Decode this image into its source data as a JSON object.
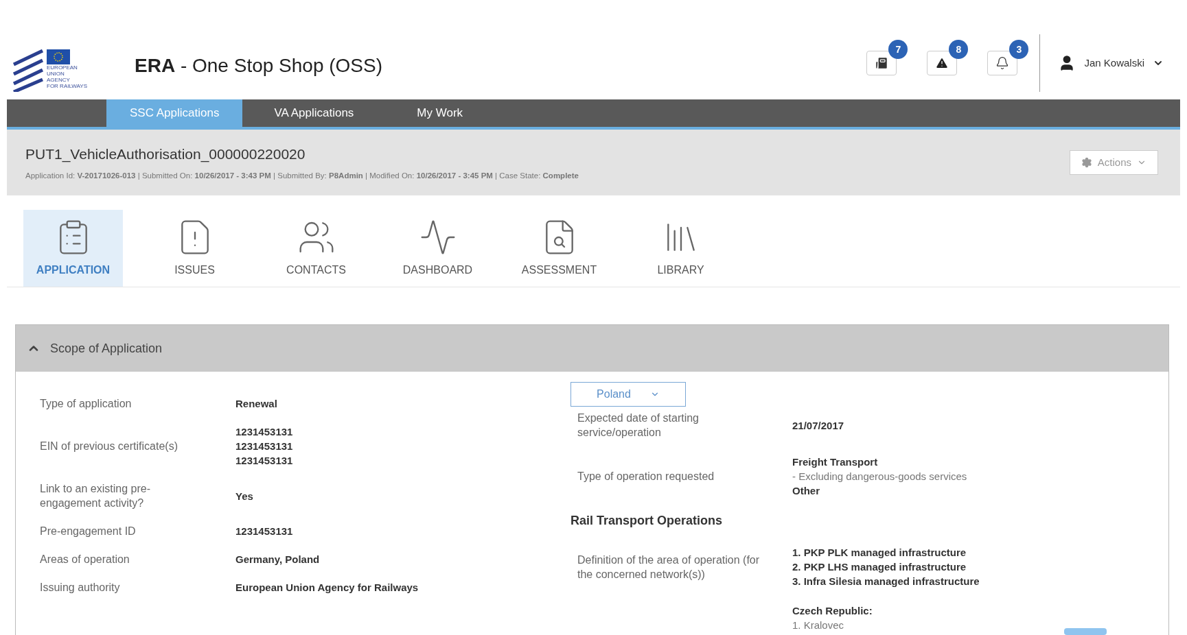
{
  "logo": {
    "lines": [
      "EUROPEAN",
      "UNION",
      "AGENCY",
      "FOR RAILWAYS"
    ]
  },
  "app_title": {
    "bold": "ERA",
    "rest": " - One Stop Shop (OSS)"
  },
  "header_icons": [
    {
      "kind": "messages",
      "badge": "7"
    },
    {
      "kind": "alert",
      "badge": "8"
    },
    {
      "kind": "bell",
      "badge": "3"
    }
  ],
  "user": {
    "name": "Jan Kowalski"
  },
  "nav_tabs": [
    {
      "label": "SSC Applications",
      "selected": true
    },
    {
      "label": "VA Applications",
      "selected": false
    },
    {
      "label": "My Work",
      "selected": false
    }
  ],
  "case": {
    "title": "PUT1_VehicleAuthorisation_000000220020",
    "meta": "Application Id: **V-20171026-013** | Submitted On: **10/26/2017 - 3:43 PM** | Submitted By: **P8Admin** | Modified On: **10/26/2017 - 3:45 PM** | Case State: **Complete**",
    "actions_button": "Actions"
  },
  "sections": [
    {
      "label": "APPLICATION",
      "kind": "clipboard",
      "selected": true
    },
    {
      "label": "ISSUES",
      "kind": "issues",
      "selected": false
    },
    {
      "label": "CONTACTS",
      "kind": "contacts",
      "selected": false
    },
    {
      "label": "DASHBOARD",
      "kind": "dashboard",
      "selected": false
    },
    {
      "label": "ASSESSMENT",
      "kind": "assessment",
      "selected": false
    },
    {
      "label": "LIBRARY",
      "kind": "library",
      "selected": false
    }
  ],
  "panel": {
    "title": "Scope of Application",
    "expanded": true,
    "left_rows": [
      {
        "label": "Type of application",
        "lines": [
          {
            "text": "Renewal",
            "bold": true
          }
        ]
      },
      {
        "label": "EIN of previous certificate(s)",
        "lines": [
          {
            "text": "1231453131",
            "bold": true
          },
          {
            "text": "1231453131",
            "bold": true
          },
          {
            "text": "1231453131",
            "bold": true
          }
        ]
      },
      {
        "label": "Link to an existing pre-engagement activity?",
        "lines": [
          {
            "text": "Yes",
            "bold": true
          }
        ]
      },
      {
        "label": "Pre-engagement ID",
        "lines": [
          {
            "text": "1231453131",
            "bold": true
          }
        ]
      },
      {
        "label": "Areas of operation",
        "lines": [
          {
            "text": "Germany, Poland",
            "bold": true
          }
        ]
      },
      {
        "label": "Issuing authority",
        "lines": [
          {
            "text": "European Union Agency for Railways",
            "bold": true
          }
        ]
      }
    ],
    "country_select": "Poland",
    "right_items": [
      {
        "kind": "row",
        "label": "Expected date of starting service/operation",
        "lines": [
          {
            "text": "21/07/2017",
            "bold": true
          }
        ]
      },
      {
        "kind": "row",
        "label": "Type of operation requested",
        "lines": [
          {
            "text": "Freight Transport",
            "bold": true
          },
          {
            "text": "- Excluding dangerous-goods services",
            "bold": false
          },
          {
            "text": "Other",
            "bold": true
          }
        ]
      },
      {
        "kind": "heading",
        "text": "Rail Transport Operations"
      },
      {
        "kind": "row",
        "label": "Definition of the area of operation (for the concerned network(s))",
        "lines": [
          {
            "text": "1. PKP PLK managed infrastructure",
            "bold": true
          },
          {
            "text": "2. PKP LHS managed infrastructure",
            "bold": true
          },
          {
            "text": "3. Infra Silesia managed infrastructure",
            "bold": true
          }
        ]
      },
      {
        "kind": "row",
        "lines": [
          {
            "text": "Czech Republic:",
            "bold": true
          },
          {
            "text": "1. Kralovec",
            "bold": false
          }
        ]
      }
    ]
  }
}
